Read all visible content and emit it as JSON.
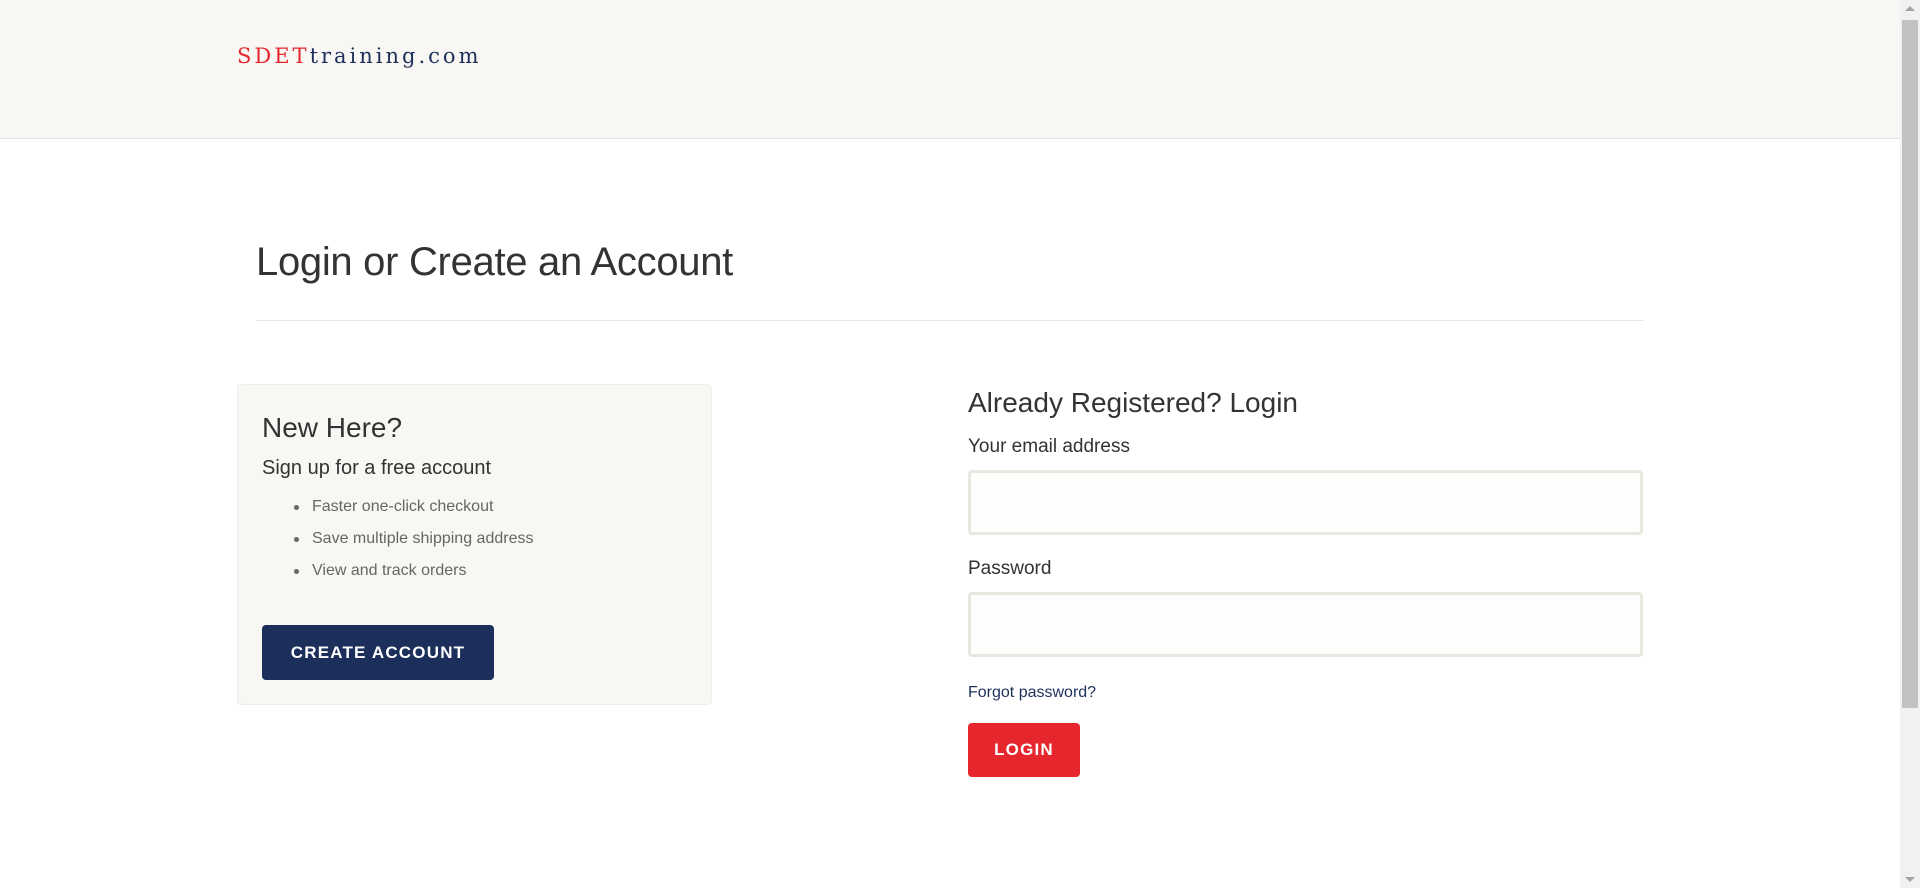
{
  "header": {
    "logo_part1": "SDET",
    "logo_part2": "training.com"
  },
  "page": {
    "title": "Login or Create an Account"
  },
  "new_account": {
    "heading": "New Here?",
    "subheading": "Sign up for a free account",
    "benefits": [
      "Faster one-click checkout",
      "Save multiple shipping address",
      "View and track orders"
    ],
    "button_label": "Create Account"
  },
  "login": {
    "heading": "Already Registered? Login",
    "email_label": "Your email address",
    "email_value": "",
    "password_label": "Password",
    "password_value": "",
    "forgot_link": "Forgot password?",
    "button_label": "Login"
  },
  "colors": {
    "brand_red": "#e5262d",
    "brand_navy": "#1c2f5a",
    "panel_bg": "#f8f7f4"
  }
}
